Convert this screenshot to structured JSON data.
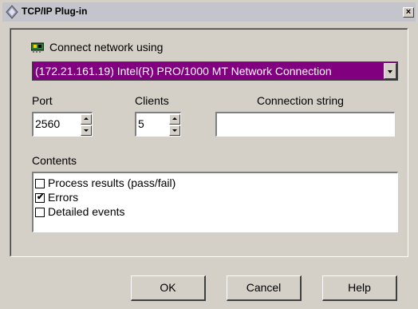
{
  "window": {
    "title": "TCP/IP Plug-in",
    "close_glyph": "×"
  },
  "connect": {
    "label": "Connect network using",
    "icon": "network-card-icon",
    "selected": "(172.21.161.19) Intel(R) PRO/1000 MT Network Connection"
  },
  "port": {
    "label": "Port",
    "value": "2560"
  },
  "clients": {
    "label": "Clients",
    "value": "5"
  },
  "connection_string": {
    "label": "Connection string",
    "value": ""
  },
  "contents": {
    "label": "Contents",
    "items": [
      {
        "label": "Process results (pass/fail)",
        "checked": false
      },
      {
        "label": "Errors",
        "checked": true
      },
      {
        "label": "Detailed events",
        "checked": false
      }
    ]
  },
  "buttons": {
    "ok": "OK",
    "cancel": "Cancel",
    "help": "Help"
  },
  "colors": {
    "selection": "#800080",
    "face": "#d4d0c8"
  }
}
